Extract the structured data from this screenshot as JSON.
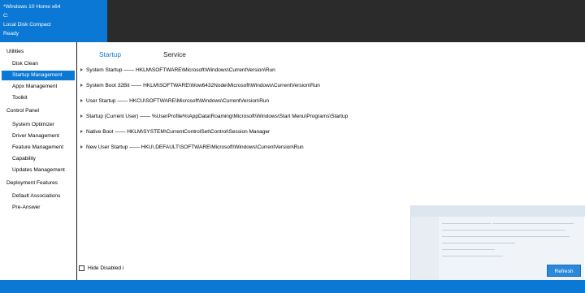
{
  "header": {
    "os": "*Windows 10 Home x64",
    "drive": "C:",
    "compact": "Local Disk Compact",
    "status": "Ready"
  },
  "sidebar": {
    "utilities": "Utilities",
    "disk_clean": "Disk Clean",
    "startup_management": "Startup Management",
    "appx_management": "Appx Management",
    "toolkit": "Toolkit",
    "control_panel": "Control Panel",
    "system_optimizer": "System Optimizer",
    "driver_management": "Driver Management",
    "feature_management": "Feature Management",
    "capability": "Capability",
    "updates_management": "Updates Management",
    "deployment_features": "Deployment Features",
    "default_associations": "Default Associations",
    "pre_answer": "Pre-Answer"
  },
  "tabs": {
    "startup": "Startup",
    "service": "Service"
  },
  "entries": [
    "System Startup —— HKLM\\SOFTWARE\\Microsoft\\Windows\\CurrentVersion\\Run",
    "System Boot 32Bit —— HKLM\\SOFTWARE\\Wow6432Node\\Microsoft\\Windows\\CurrentVersion\\Run",
    "User Startup —— HKCU\\SOFTWARE\\Microsoft\\Windows\\CurrentVersion\\Run",
    "Startup (Current User) —— %UserProfile%\\AppData\\Roaming\\Microsoft\\Windows\\Start Menu\\Programs\\Startup",
    "Native Boot —— HKLM\\SYSTEM\\CurrentControlSet\\Control\\Session Manager",
    "New User Startup —— HKU\\.DEFAULT\\SOFTWARE\\Microsoft\\Windows\\CurrentVersion\\Run"
  ],
  "footer": {
    "hide_disabled": "Hide Disabled i",
    "refresh": "Refresh"
  },
  "colors": {
    "accent": "#0a78d4",
    "header_dark": "#2b2b2b"
  }
}
